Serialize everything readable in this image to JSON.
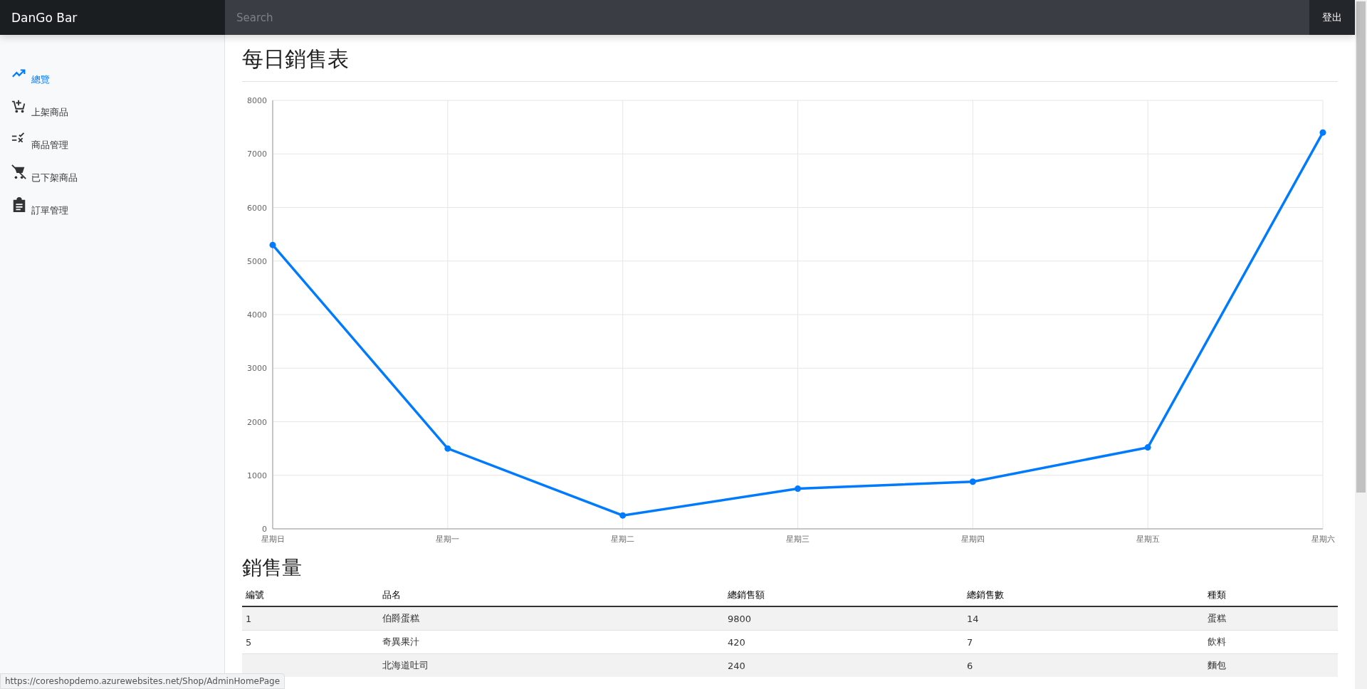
{
  "navbar": {
    "brand": "DanGo Bar",
    "search": {
      "placeholder": "Search"
    },
    "signout": "登出"
  },
  "sidebar": {
    "items": [
      {
        "label": "總覽",
        "selected": true
      },
      {
        "label": "上架商品",
        "selected": false
      },
      {
        "label": "商品管理",
        "selected": false
      },
      {
        "label": "已下架商品",
        "selected": false
      },
      {
        "label": "訂單管理",
        "selected": false
      }
    ]
  },
  "main": {
    "title": "每日銷售表",
    "chart_data": {
      "type": "line",
      "categories": [
        "星期日",
        "星期一",
        "星期二",
        "星期三",
        "星期四",
        "星期五",
        "星期六"
      ],
      "series": [
        {
          "color": "#007bff",
          "marker": true,
          "values": [
            5300,
            1500,
            250,
            750,
            880,
            1520,
            7400
          ]
        }
      ],
      "grid": true,
      "ylim": [
        0,
        8000
      ],
      "yticks": [
        0,
        1000,
        2000,
        3000,
        4000,
        5000,
        6000,
        7000,
        8000
      ]
    },
    "table_title": "銷售量",
    "table": {
      "columns": [
        "編號",
        "品名",
        "總銷售額",
        "總銷售數",
        "種類"
      ],
      "rows": [
        [
          "1",
          "伯爵蛋糕",
          "9800",
          "14",
          "蛋糕"
        ],
        [
          "5",
          "奇異果汁",
          "420",
          "7",
          "飲料"
        ],
        [
          "",
          "北海道吐司",
          "240",
          "6",
          "麵包"
        ]
      ]
    }
  },
  "status_link": "https://coreshopdemo.azurewebsites.net/Shop/AdminHomePage"
}
